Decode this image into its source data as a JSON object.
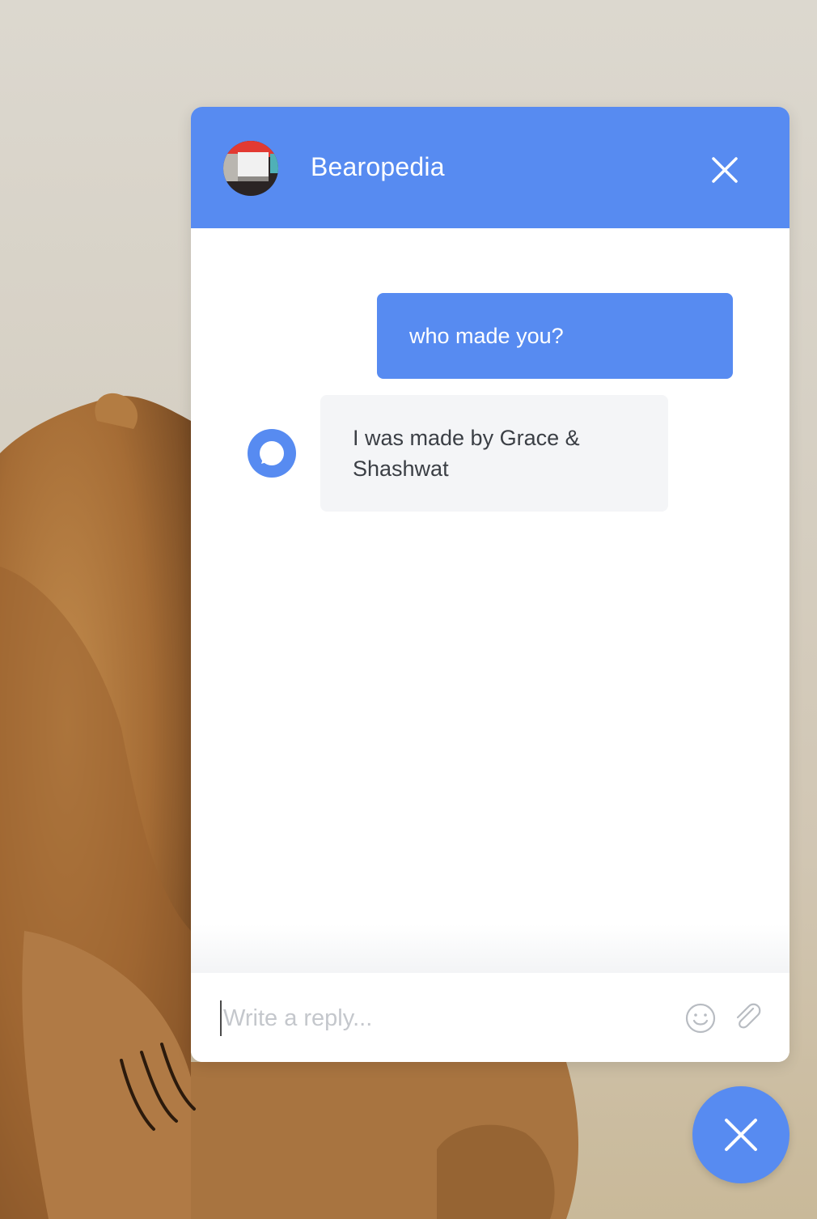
{
  "chat": {
    "title": "Bearopedia",
    "messages": [
      {
        "sender": "user",
        "text": "who made you?"
      },
      {
        "sender": "bot",
        "text": "I was made by Grace & Shashwat"
      }
    ],
    "composer": {
      "placeholder": "Write a reply...",
      "value": ""
    }
  },
  "icons": {
    "header_close": "close-icon",
    "bot_avatar": "chat-bubble-icon",
    "emoji": "smiley-icon",
    "attach": "paperclip-icon",
    "launcher": "close-icon"
  },
  "colors": {
    "accent": "#578bf1",
    "bot_bubble": "#f4f5f7",
    "text_dark": "#3b3f45",
    "placeholder": "#c4c7cc"
  }
}
